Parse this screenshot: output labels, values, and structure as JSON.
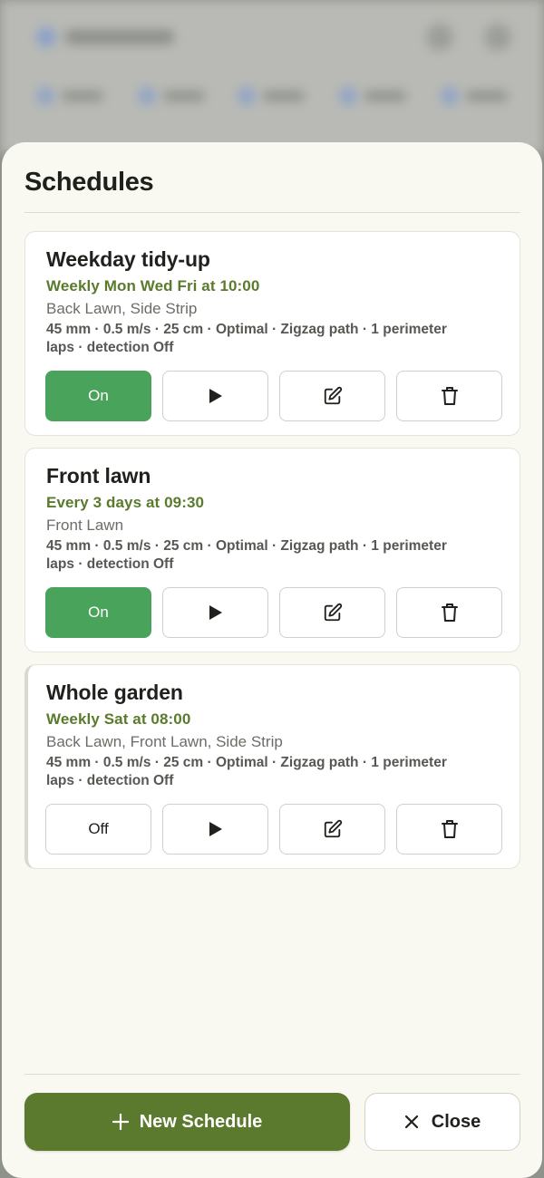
{
  "sheet": {
    "title": "Schedules"
  },
  "schedules": [
    {
      "name": "Weekday tidy-up",
      "when": "Weekly Mon Wed Fri at 10:00",
      "zones": "Back Lawn, Side Strip",
      "details": "45 mm · 0.5 m/s · 25 cm · Optimal · Zigzag path · 1 perimeter laps · detection Off",
      "toggle_label": "On",
      "enabled": true
    },
    {
      "name": "Front lawn",
      "when": "Every 3 days at 09:30",
      "zones": "Front Lawn",
      "details": "45 mm · 0.5 m/s · 25 cm · Optimal · Zigzag path · 1 perimeter laps · detection Off",
      "toggle_label": "On",
      "enabled": true
    },
    {
      "name": "Whole garden",
      "when": "Weekly Sat at 08:00",
      "zones": "Back Lawn, Front Lawn, Side Strip",
      "details": "45 mm · 0.5 m/s · 25 cm · Optimal · Zigzag path · 1 perimeter laps · detection Off",
      "toggle_label": "Off",
      "enabled": false
    }
  ],
  "footer": {
    "new_label": "New Schedule",
    "close_label": "Close"
  },
  "icons": {
    "run": "play-icon",
    "edit": "edit-icon",
    "delete": "trash-icon",
    "new": "plus-icon",
    "close": "close-icon"
  },
  "colors": {
    "accent": "#5b7a2e",
    "on": "#4aa35a",
    "schedule_text": "#5a7a2c",
    "sheet_bg": "#f9f8f1"
  }
}
